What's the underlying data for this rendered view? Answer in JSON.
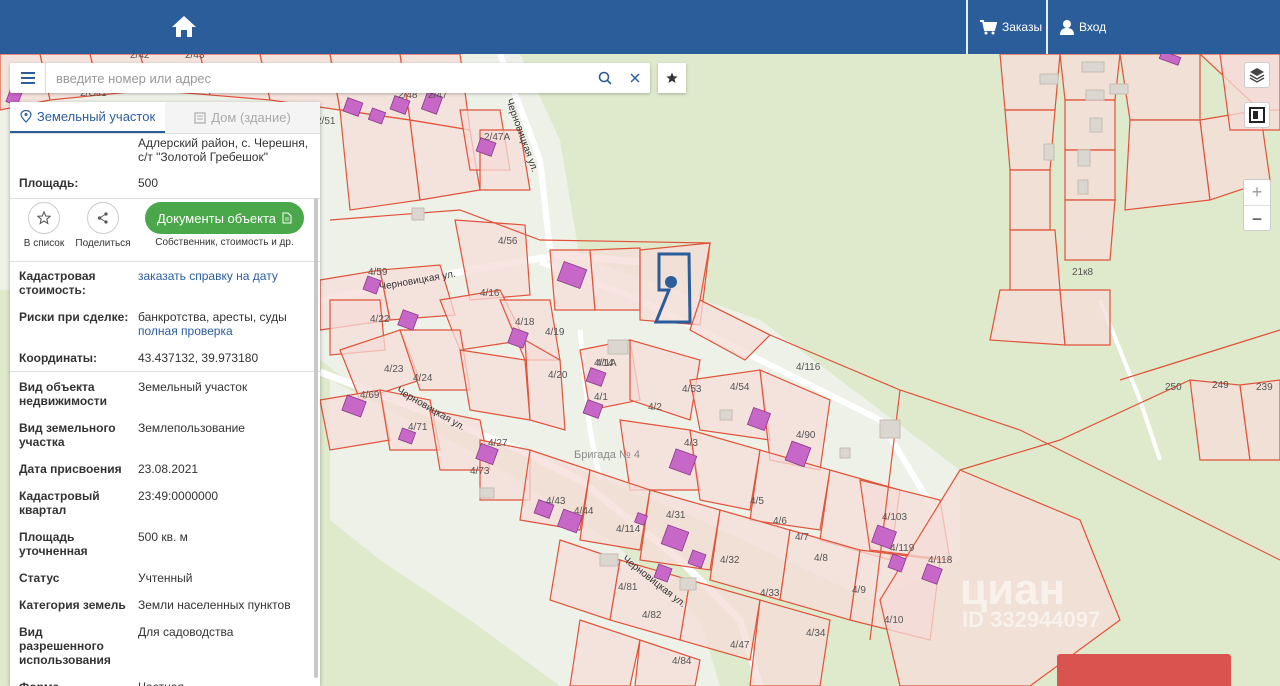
{
  "header": {
    "orders_label": "Заказы",
    "login_label": "Вход"
  },
  "search": {
    "placeholder": "введите номер или адрес"
  },
  "panel": {
    "tabs": [
      {
        "label": "Земельный участок",
        "active": true
      },
      {
        "label": "Дом (здание)",
        "active": false
      }
    ],
    "address": "Адлерский район, с. Черешня, с/т \"Золотой Гребешок\"",
    "area_label": "Площадь:",
    "area_value": "500",
    "actions": {
      "list_label": "В список",
      "share_label": "Поделиться",
      "docs_button": "Документы объекта",
      "docs_sub": "Собственник, стоимость и др."
    },
    "cad_cost_label": "Кадастровая стоимость:",
    "cad_cost_link": "заказать справку на дату",
    "risks_label": "Риски при сделке:",
    "risks_value": "банкротства, аресты, суды",
    "risks_link": "полная проверка",
    "coords_label": "Координаты:",
    "coords_value": "43.437132, 39.973180",
    "fields": [
      {
        "label": "Вид объекта недвижимости",
        "value": "Земельный участок"
      },
      {
        "label": "Вид земельного участка",
        "value": "Землепользование"
      },
      {
        "label": "Дата присвоения",
        "value": "23.08.2021"
      },
      {
        "label": "Кадастровый квартал",
        "value": "23:49:0000000"
      },
      {
        "label": "Площадь уточненная",
        "value": "500 кв. м"
      },
      {
        "label": "Статус",
        "value": "Учтенный"
      },
      {
        "label": "Категория земель",
        "value": "Земли населенных пунктов"
      },
      {
        "label": "Вид разрешенного использования",
        "value": "Для садоводства"
      },
      {
        "label": "Форма",
        "value": "Частная"
      }
    ]
  },
  "map": {
    "streets": [
      "Черновицкая ул.",
      "Черновицкая ул.",
      "Черновицкая ул.",
      "Черновицкая ул."
    ],
    "area_label": "Бригада № 4",
    "parcels": [
      "2/42",
      "2/43",
      "2/Ос1",
      "2/48",
      "2/47",
      "2/47А",
      "2/51",
      "4/56",
      "4/59",
      "4/16",
      "4/22",
      "4/18",
      "4/19",
      "4/23",
      "4/24",
      "4/69",
      "4/20",
      "4/14",
      "4/1",
      "4/53",
      "4/54",
      "4/116",
      "4/2",
      "4/71",
      "4/27",
      "4/3",
      "4/90",
      "4/73",
      "4/43",
      "4/5",
      "4/44",
      "4/31",
      "4/6",
      "4/103",
      "4/114",
      "4/7",
      "4/119",
      "4/118",
      "4/8",
      "4/32",
      "4/81",
      "4/9",
      "4/33",
      "4/82",
      "4/10",
      "4/34",
      "4/47",
      "4/84",
      "4/1А",
      "21к8",
      "250",
      "249",
      "239"
    ],
    "watermark": "циан",
    "watermark_id": "ID 332944097"
  },
  "colors": {
    "header": "#2b5d9b",
    "parcel_fill": "#f5dcd8",
    "parcel_stroke": "#e0533a",
    "building": "#c767c7",
    "selected_parcel": "#2b5d9b",
    "green": "#4aa84a"
  }
}
